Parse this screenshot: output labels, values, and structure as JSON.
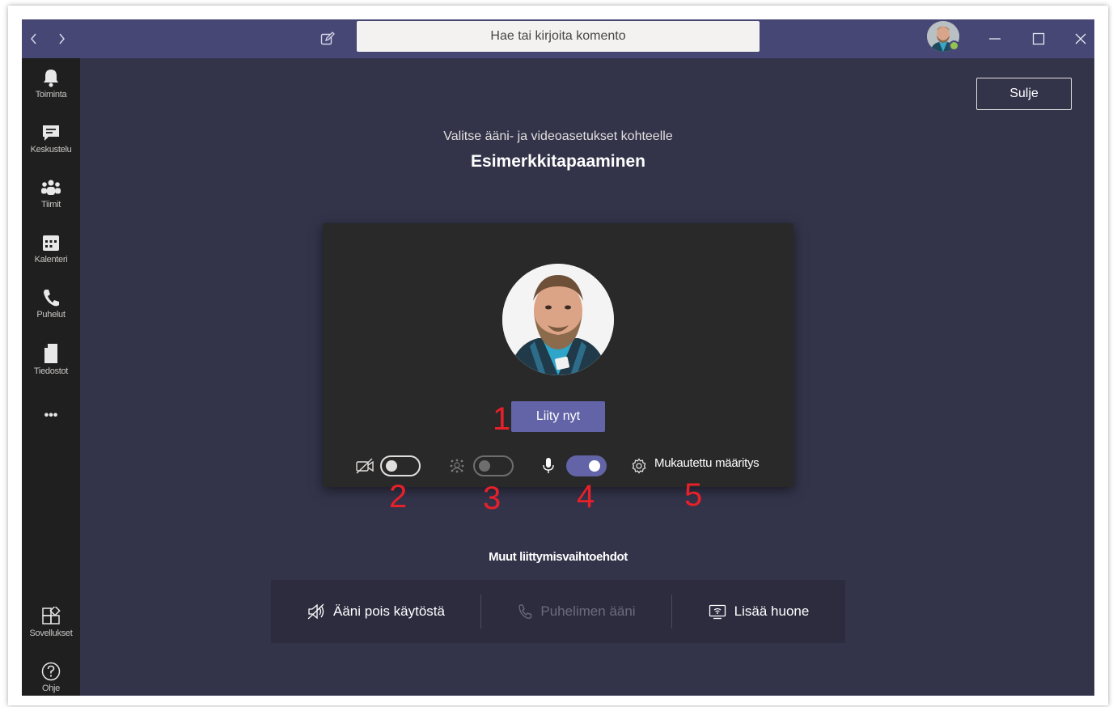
{
  "titlebar": {
    "search_placeholder": "Hae tai kirjoita komento",
    "icons": [
      "chevron-left-icon",
      "chevron-right-icon",
      "compose-icon",
      "minimize-icon",
      "maximize-icon",
      "close-icon"
    ]
  },
  "rail": {
    "items": [
      {
        "label": "Toiminta",
        "icon": "bell-icon"
      },
      {
        "label": "Keskustelu",
        "icon": "chat-icon"
      },
      {
        "label": "Tiimit",
        "icon": "teams-icon"
      },
      {
        "label": "Kalenteri",
        "icon": "calendar-icon"
      },
      {
        "label": "Puhelut",
        "icon": "phone-icon"
      },
      {
        "label": "Tiedostot",
        "icon": "file-icon"
      }
    ],
    "more_label": "•••",
    "bottom": [
      {
        "label": "Sovellukset",
        "icon": "apps-icon"
      },
      {
        "label": "Ohje",
        "icon": "help-icon"
      }
    ]
  },
  "main": {
    "close_label": "Sulje",
    "subtitle": "Valitse ääni- ja videoasetukset kohteelle",
    "meeting_title": "Esimerkkitapaaminen",
    "join_label": "Liity nyt",
    "custom_setup_label": "Mukautettu määritys",
    "controls": {
      "camera_on": false,
      "blur_on": false,
      "blur_disabled": true,
      "mic_on": true
    },
    "annotations": [
      "1",
      "2",
      "3",
      "4",
      "5"
    ],
    "other_options_title": "Muut liittymisvaihtoehdot",
    "other_options": [
      {
        "label": "Ääni pois käytöstä",
        "icon": "speaker-off-icon",
        "enabled": true
      },
      {
        "label": "Puhelimen ääni",
        "icon": "phone-icon",
        "enabled": false
      },
      {
        "label": "Lisää huone",
        "icon": "room-icon",
        "enabled": true
      }
    ]
  },
  "colors": {
    "accent": "#6264a7",
    "titlebar": "#464775",
    "background": "#33344a",
    "rail": "#1f1f1f",
    "annotation": "#e8202a",
    "presence": "#92c353"
  }
}
